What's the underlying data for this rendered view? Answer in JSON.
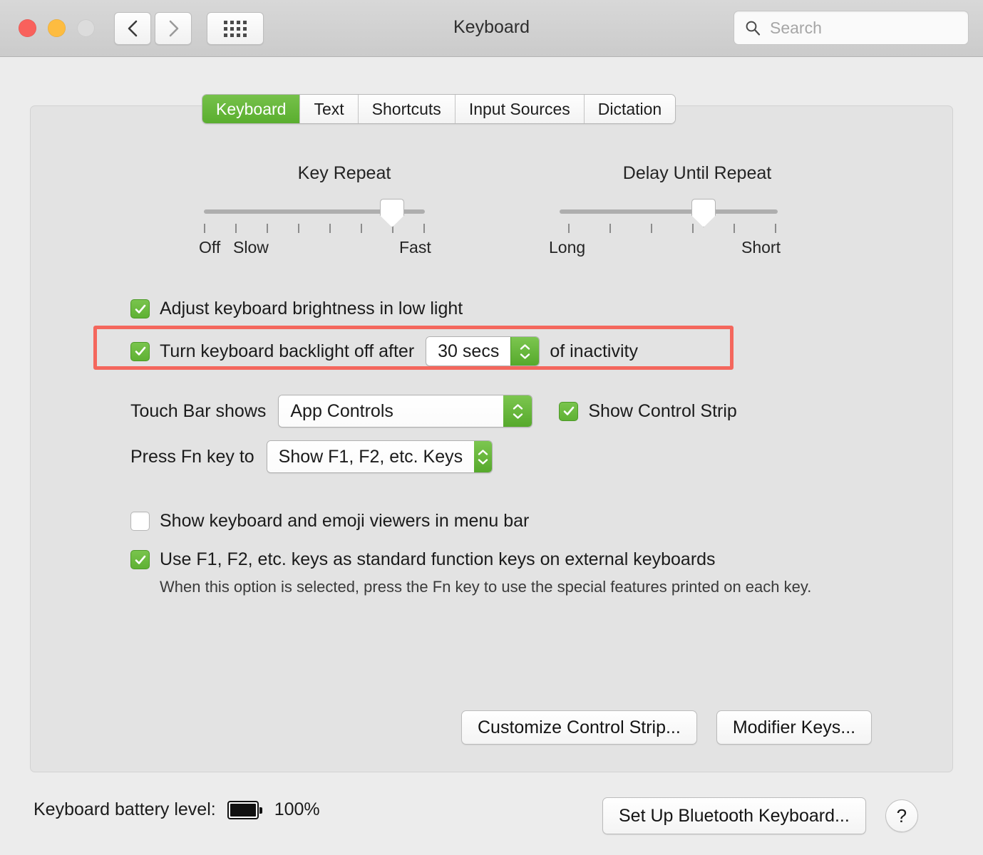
{
  "window": {
    "title": "Keyboard",
    "traffic_lights": [
      "close",
      "minimize",
      "zoom"
    ],
    "nav": {
      "back": "back-chevron",
      "forward": "forward-chevron",
      "grid": "show-all-grid"
    },
    "search": {
      "placeholder": "Search",
      "value": "",
      "icon": "search-icon"
    }
  },
  "tabs": [
    {
      "label": "Keyboard",
      "active": true
    },
    {
      "label": "Text",
      "active": false
    },
    {
      "label": "Shortcuts",
      "active": false
    },
    {
      "label": "Input Sources",
      "active": false
    },
    {
      "label": "Dictation",
      "active": false
    }
  ],
  "sliders": [
    {
      "title": "Key Repeat",
      "left_label": "Off",
      "second_label": "Slow",
      "right_label": "Fast",
      "ticks": 8,
      "value_index": 7
    },
    {
      "title": "Delay Until Repeat",
      "left_label": "Long",
      "second_label": "",
      "right_label": "Short",
      "ticks": 6,
      "value_index": 5
    }
  ],
  "options": {
    "adjust_brightness": {
      "label": "Adjust keyboard brightness in low light",
      "checked": true
    },
    "backlight_off": {
      "label_before": "Turn keyboard backlight off after",
      "stepper_value": "30 secs",
      "label_after": "of inactivity",
      "checked": true,
      "highlighted": true
    },
    "touch_bar": {
      "label": "Touch Bar shows",
      "value": "App Controls"
    },
    "control_strip": {
      "label": "Show Control Strip",
      "checked": true
    },
    "fn_key": {
      "label": "Press Fn key to",
      "value": "Show F1, F2, etc. Keys"
    },
    "emoji_viewer": {
      "label": "Show keyboard and emoji viewers in menu bar",
      "checked": false
    },
    "function_keys": {
      "label": "Use F1, F2, etc. keys as standard function keys on external keyboards",
      "checked": true,
      "note": "When this option is selected, press the Fn key to use the special features printed on each key."
    }
  },
  "panel_buttons": {
    "customize_control_strip": "Customize Control Strip...",
    "modifier_keys": "Modifier Keys..."
  },
  "footer": {
    "battery_label": "Keyboard battery level:",
    "battery_percent": "100%",
    "battery_fill": 100,
    "setup_bluetooth": "Set Up Bluetooth Keyboard...",
    "help": "?"
  },
  "colors": {
    "accent_green": "#5fb134",
    "highlight_red": "#f4675d",
    "window_bg": "#ececec",
    "panel_bg": "#e3e3e3"
  }
}
